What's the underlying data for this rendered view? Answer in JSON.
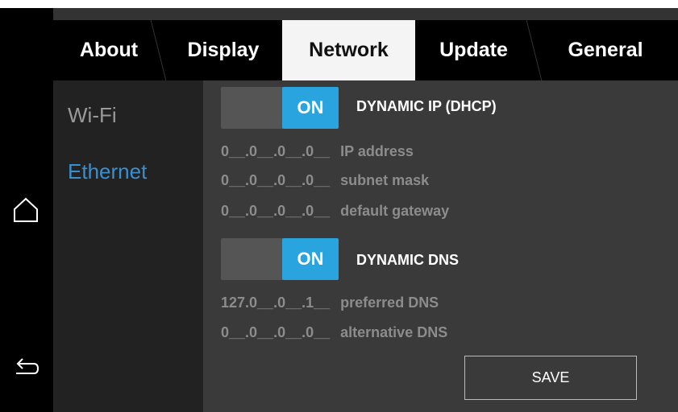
{
  "tabs": [
    {
      "label": "About",
      "active": false
    },
    {
      "label": "Display",
      "active": false
    },
    {
      "label": "Network",
      "active": true
    },
    {
      "label": "Update",
      "active": false
    },
    {
      "label": "General",
      "active": false
    }
  ],
  "sidebar": {
    "items": [
      {
        "label": "Wi-Fi",
        "active": false
      },
      {
        "label": "Ethernet",
        "active": true
      }
    ]
  },
  "network": {
    "dhcp": {
      "toggle_label": "ON",
      "label": "DYNAMIC IP (DHCP)",
      "on": true
    },
    "ip_address": {
      "value": "0__.0__.0__.0__",
      "label": "IP address"
    },
    "subnet_mask": {
      "value": "0__.0__.0__.0__",
      "label": "subnet mask"
    },
    "default_gateway": {
      "value": "0__.0__.0__.0__",
      "label": "default gateway"
    },
    "dns": {
      "toggle_label": "ON",
      "label": "DYNAMIC DNS",
      "on": true
    },
    "preferred_dns": {
      "value": "127.0__.0__.1__",
      "label": "preferred DNS"
    },
    "alternative_dns": {
      "value": "0__.0__.0__.0__",
      "label": "alternative DNS"
    },
    "save_label": "SAVE"
  },
  "nav": {
    "icons": [
      "home-icon",
      "back-icon"
    ]
  },
  "colors": {
    "accent": "#29a4de",
    "link_active": "#3a8fcf"
  }
}
